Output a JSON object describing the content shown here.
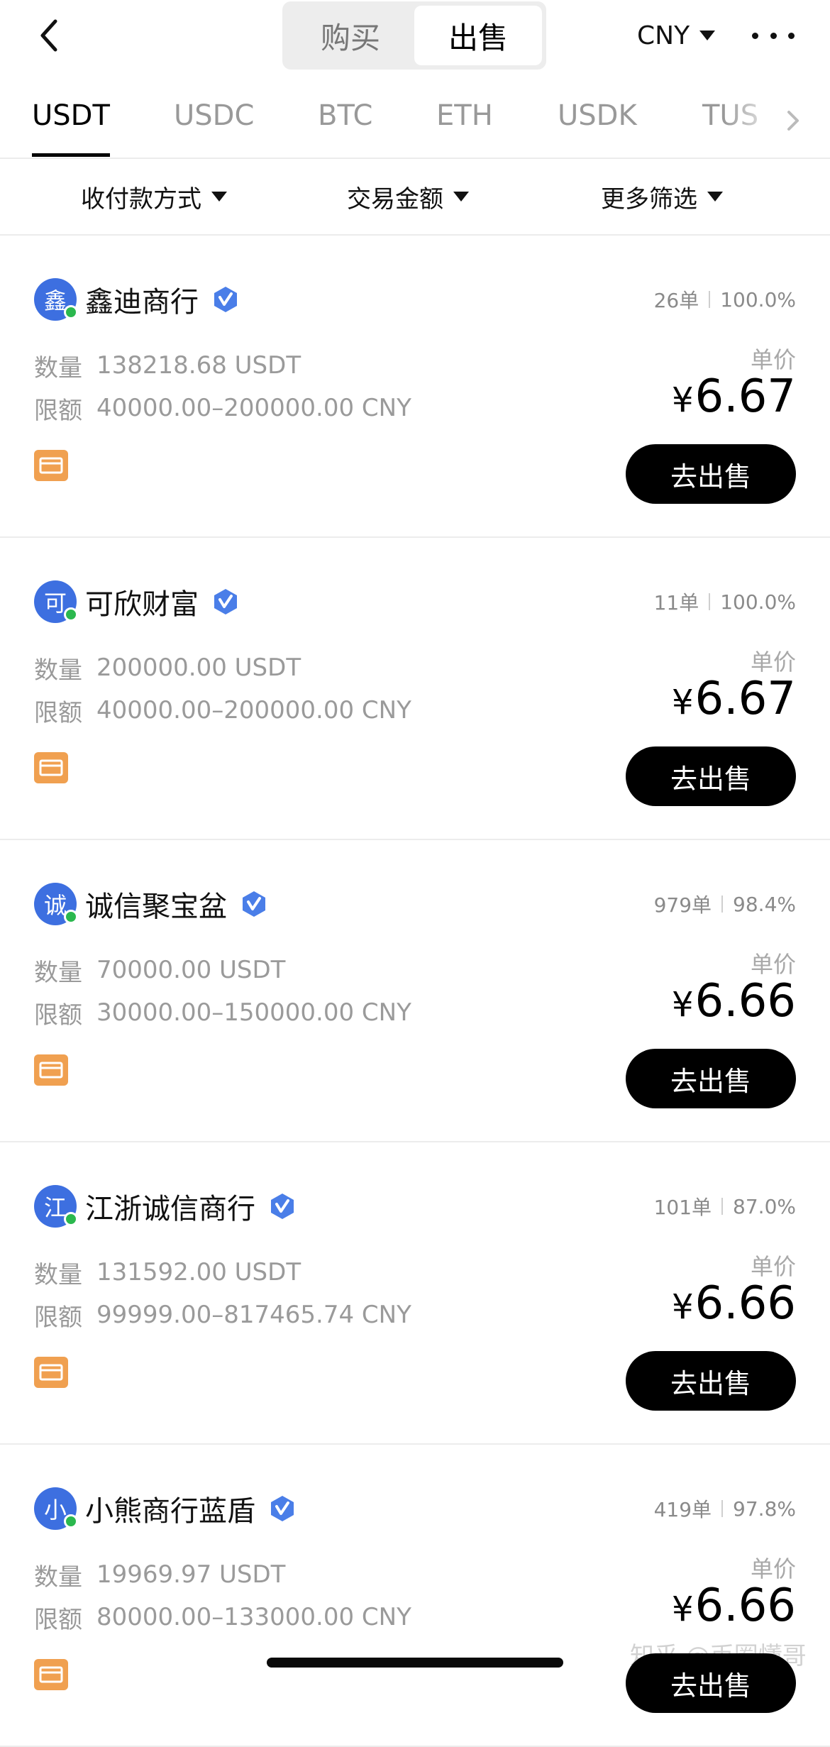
{
  "header": {
    "segment_buy": "购买",
    "segment_sell": "出售",
    "currency": "CNY"
  },
  "coin_tabs": [
    "USDT",
    "USDC",
    "BTC",
    "ETH",
    "USDK",
    "TUS"
  ],
  "active_coin_tab": "USDT",
  "filters": {
    "payment_method": "收付款方式",
    "trade_amount": "交易金额",
    "more_filters": "更多筛选"
  },
  "labels": {
    "quantity": "数量",
    "limit": "限额",
    "unit_price": "单价",
    "sell_button": "去出售",
    "yen": "¥"
  },
  "ads": [
    {
      "avatar_char": "鑫",
      "merchant": "鑫迪商行",
      "orders": "26单",
      "completion": "100.0%",
      "quantity": "138218.68 USDT",
      "limit": "40000.00–200000.00 CNY",
      "price": "6.67"
    },
    {
      "avatar_char": "可",
      "merchant": "可欣财富",
      "orders": "11单",
      "completion": "100.0%",
      "quantity": "200000.00 USDT",
      "limit": "40000.00–200000.00 CNY",
      "price": "6.67"
    },
    {
      "avatar_char": "诚",
      "merchant": "诚信聚宝盆",
      "orders": "979单",
      "completion": "98.4%",
      "quantity": "70000.00 USDT",
      "limit": "30000.00–150000.00 CNY",
      "price": "6.66"
    },
    {
      "avatar_char": "江",
      "merchant": "江浙诚信商行",
      "orders": "101单",
      "completion": "87.0%",
      "quantity": "131592.00 USDT",
      "limit": "99999.00–817465.74 CNY",
      "price": "6.66"
    },
    {
      "avatar_char": "小",
      "merchant": "小熊商行蓝盾",
      "orders": "419单",
      "completion": "97.8%",
      "quantity": "19969.97 USDT",
      "limit": "80000.00–133000.00 CNY",
      "price": "6.66"
    }
  ],
  "watermark": "知乎 @币圈懂哥",
  "colors": {
    "brand_blue": "#3d6fe0",
    "verify_badge": "#4a7ee8",
    "payment_icon": "#f0a050",
    "online_dot": "#2bb84e",
    "primary_button": "#000000"
  }
}
